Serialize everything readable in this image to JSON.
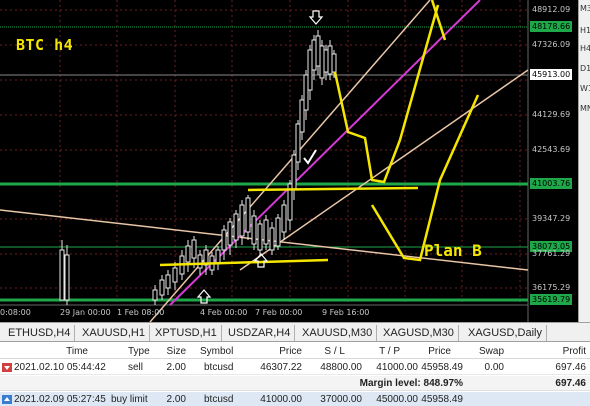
{
  "chart": {
    "title": "BTC h4",
    "plan_label": "Plan B",
    "colors": {
      "grid": "#6b1f1f",
      "level": "#1ea84a",
      "annotation": "#f5e600",
      "trend": "#d63ad6",
      "channel": "#e8c6a6"
    },
    "price_labels": [
      "48912.09",
      "47326.09",
      "44129.69",
      "42543.69",
      "39347.29",
      "37761.29",
      "36175.29"
    ],
    "price_boxes": [
      {
        "text": "48178.66",
        "style": "green"
      },
      {
        "text": "45913.00",
        "style": "white"
      },
      {
        "text": "41003.76",
        "style": "green"
      },
      {
        "text": "38073.05",
        "style": "green"
      },
      {
        "text": "35619.79",
        "style": "green"
      }
    ],
    "time_labels": [
      "0:08:00",
      "29 Jan 00:00",
      "1 Feb 08:00",
      "4 Feb 00:00",
      "7 Feb 00:00",
      "9 Feb 16:00"
    ]
  },
  "timeframes": [
    "M30",
    "H1",
    "H4",
    "D1",
    "W1",
    "MN"
  ],
  "tabs": [
    "ETHUSD,H4",
    "XAUUSD,H1",
    "XPTUSD,H1",
    "USDZAR,H4",
    "XAUUSD,M30",
    "XAGUSD,M30",
    "XAGUSD,Daily"
  ],
  "trade_table": {
    "headers": [
      "Time",
      "Type",
      "Size",
      "Symbol",
      "Price",
      "S / L",
      "T / P",
      "Price",
      "Swap",
      "Profit"
    ],
    "rows": [
      [
        "2021.02.10 05:44:42",
        "sell",
        "2.00",
        "btcusd",
        "46307.22",
        "48800.00",
        "41000.00",
        "45958.49",
        "0.00",
        "697.46"
      ],
      [
        "2021.02.09 05:27:45",
        "buy limit",
        "2.00",
        "btcusd",
        "41000.00",
        "37000.00",
        "45000.00",
        "45958.49",
        "",
        ""
      ]
    ],
    "margin_label": "Margin level: 848.97%",
    "margin_profit": "697.46"
  }
}
